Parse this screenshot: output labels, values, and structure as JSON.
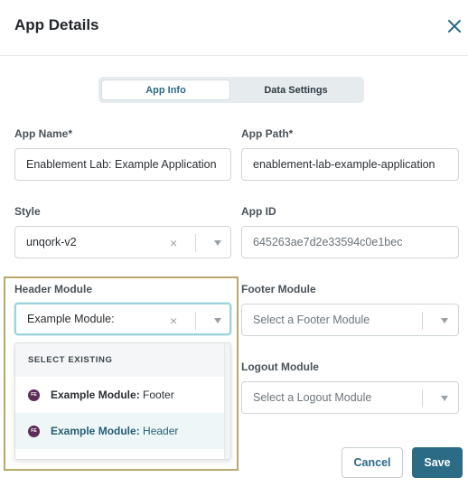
{
  "dialog": {
    "title": "App Details"
  },
  "tabs": [
    {
      "label": "App Info",
      "active": true
    },
    {
      "label": "Data Settings",
      "active": false
    }
  ],
  "fields": {
    "app_name": {
      "label": "App Name*",
      "value": "Enablement Lab: Example Application"
    },
    "app_path": {
      "label": "App Path*",
      "value": "enablement-lab-example-application"
    },
    "style": {
      "label": "Style",
      "value": "unqork-v2"
    },
    "app_id": {
      "label": "App ID",
      "value": "645263ae7d2e33594c0e1bec"
    },
    "header_module": {
      "label": "Header Module",
      "value": "Example Module:"
    },
    "footer_module": {
      "label": "Footer Module",
      "placeholder": "Select a Footer Module"
    },
    "logout_module": {
      "label": "Logout Module",
      "placeholder": "Select a Logout Module"
    }
  },
  "dropdown": {
    "section_label": "SELECT EXISTING",
    "items": [
      {
        "badge": "FE",
        "name": "Example Module:",
        "suffix": " Footer",
        "active": false
      },
      {
        "badge": "FE",
        "name": "Example Module:",
        "suffix": " Header",
        "active": true
      }
    ]
  },
  "icons": {
    "close": "×",
    "clear": "×"
  },
  "buttons": {
    "cancel": "Cancel",
    "save": "Save"
  },
  "colors": {
    "accent": "#2b6b85",
    "badge": "#5b2d57",
    "highlight_border": "#b7a86c"
  }
}
